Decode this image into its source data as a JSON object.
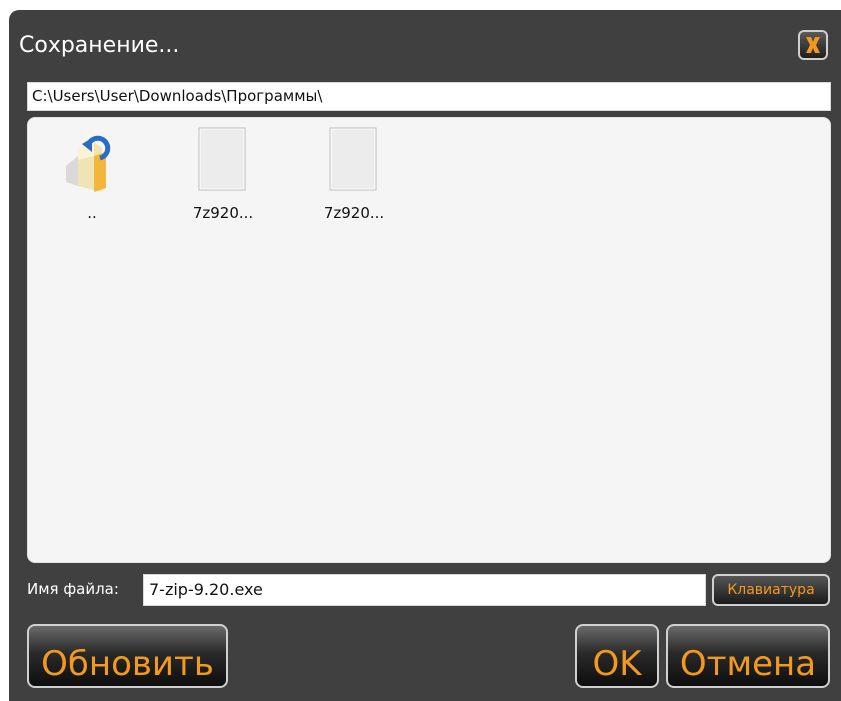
{
  "dialog": {
    "title": "Сохранение...",
    "close_label": "X"
  },
  "path": {
    "value": "C:\\Users\\User\\Downloads\\Программы\\"
  },
  "files": [
    {
      "label": "..",
      "icon": "parent-folder-icon"
    },
    {
      "label": "7z920...",
      "icon": "file-icon"
    },
    {
      "label": "7z920...",
      "icon": "file-icon"
    }
  ],
  "filename": {
    "label": "Имя файла:",
    "value": "7-zip-9.20.exe"
  },
  "buttons": {
    "keyboard": "Клавиатура",
    "refresh": "Обновить",
    "ok": "OK",
    "cancel": "Отмена"
  },
  "colors": {
    "accent": "#f39a1e",
    "background": "#404040"
  }
}
